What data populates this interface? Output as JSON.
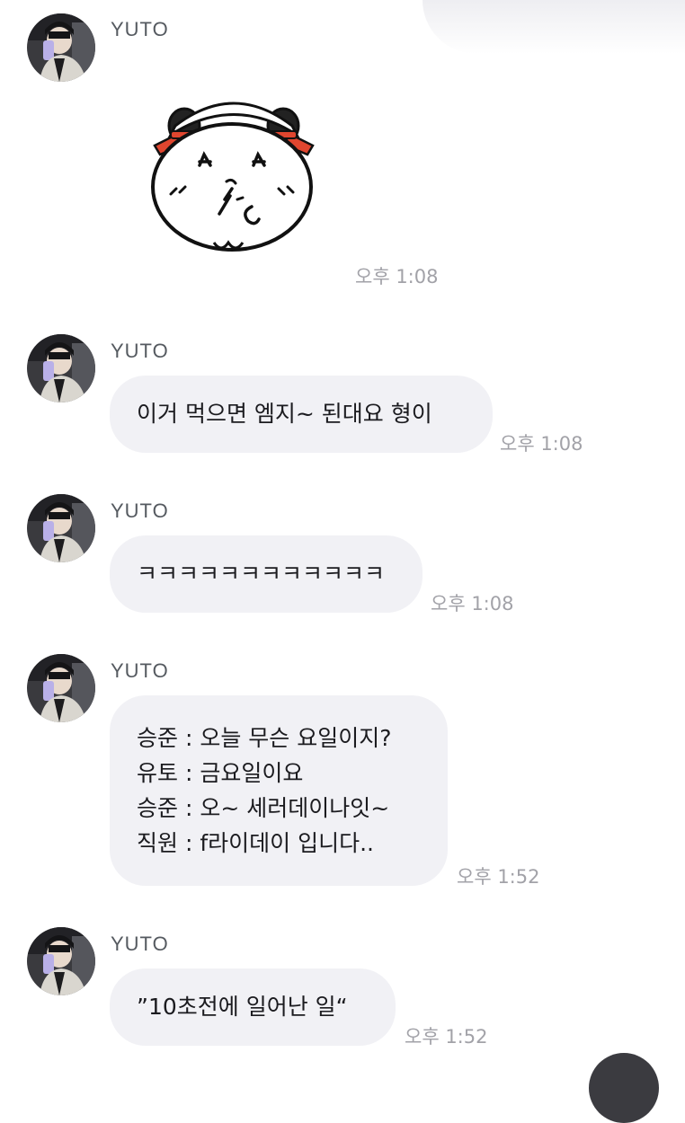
{
  "messages": [
    {
      "sender": "YUTO",
      "type": "sticker",
      "sticker_icon": "hamster-sticker-icon",
      "time": "오후 1:08"
    },
    {
      "sender": "YUTO",
      "type": "text",
      "lines": [
        "이거 먹으면 엠지~ 된대요 형이"
      ],
      "time": "오후 1:08"
    },
    {
      "sender": "YUTO",
      "type": "text",
      "lines": [
        "ㅋㅋㅋㅋㅋㅋㅋㅋㅋㅋㅋㅋ"
      ],
      "time": "오후 1:08"
    },
    {
      "sender": "YUTO",
      "type": "text",
      "lines": [
        "승준 : 오늘 무슨 요일이지?",
        "유토 : 금요일이요",
        "승준 : 오~ 세러데이나잇~",
        "직원 : f라이데이 입니다.."
      ],
      "time": "오후 1:52"
    },
    {
      "sender": "YUTO",
      "type": "text",
      "lines": [
        "”10초전에 일어난 일“"
      ],
      "time": "오후 1:52"
    }
  ],
  "colors": {
    "bubble": "#f1f1f5",
    "time": "#a2a2a8",
    "sender": "#555a60",
    "sticker_ribbon": "#e0462f"
  }
}
